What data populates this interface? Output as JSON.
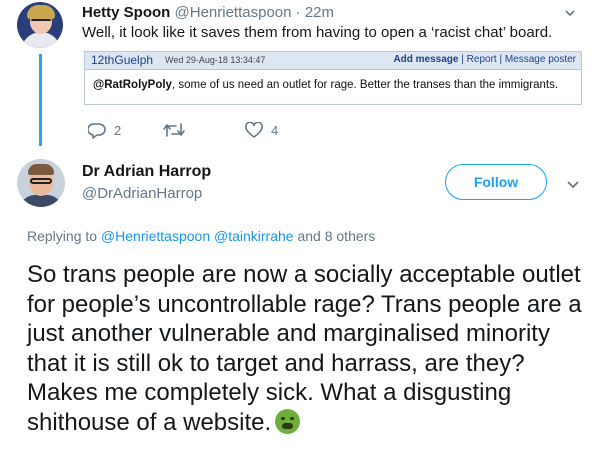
{
  "parent_tweet": {
    "name": "Hetty Spoon",
    "handle": "@Henriettaspoon",
    "separator": "·",
    "time": "22m",
    "text": "Well, it look like it saves them from having to open a ‘racist chat’ board.",
    "reply_count": "2",
    "like_count": "4",
    "embedded_post": {
      "username": "12thGuelph",
      "date": "Wed 29-Aug-18 13:34:47",
      "add_message": "Add message",
      "report": "Report",
      "message_poster": "Message poster",
      "divider": "|",
      "mention": "@RatRolyPoly",
      "message": ", some of us need an outlet for rage. Better the transes than the immigrants."
    }
  },
  "main_tweet": {
    "name": "Dr Adrian Harrop",
    "handle": "@DrAdrianHarrop",
    "follow_label": "Follow",
    "replying_prefix": "Replying to ",
    "replying_mention_1": "@Henriettaspoon",
    "replying_mention_2": "@tainkirrahe",
    "replying_suffix": " and 8 others",
    "body": "So trans people are now a socially acceptable outlet for people’s uncontrollable rage? Trans people are a just another vulnerable and marginalised minority that it is still ok to target and harrass, are they? Makes me completely sick. What a disgusting shithouse of a website.",
    "emoji": "nauseated-face"
  },
  "colors": {
    "accent": "#1da1f2",
    "mention": "#1b95e0",
    "thread_line": "#29a3ef",
    "muted": "#657786"
  }
}
